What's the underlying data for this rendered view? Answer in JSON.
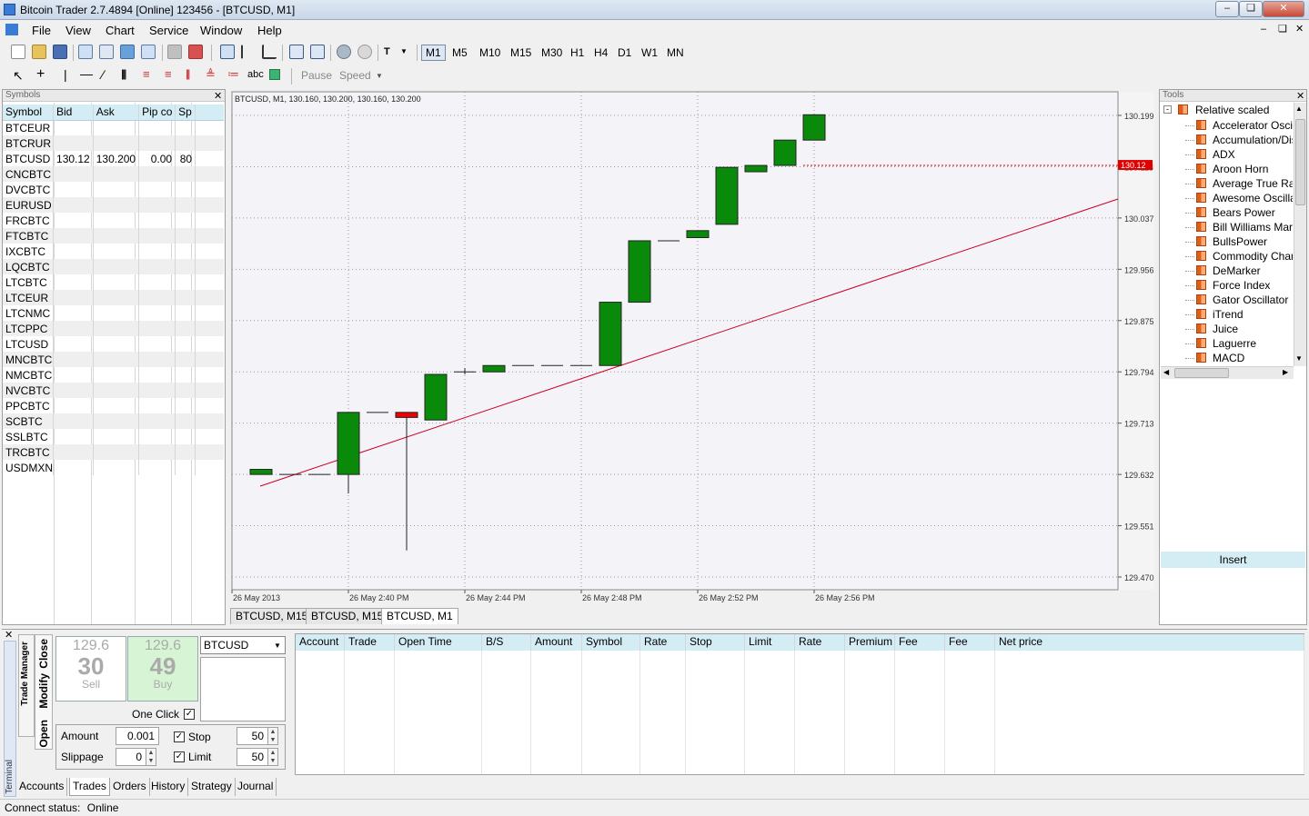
{
  "window": {
    "title": "Bitcoin Trader 2.7.4894 [Online] 123456 - [BTCUSD, M1]"
  },
  "menu": [
    "File",
    "View",
    "Chart",
    "Service",
    "Window",
    "Help"
  ],
  "timeframes": [
    "M1",
    "M5",
    "M10",
    "M15",
    "M30",
    "H1",
    "H4",
    "D1",
    "W1",
    "MN"
  ],
  "selected_timeframe": "M1",
  "toolbar2": {
    "abc": "abc",
    "pause": "Pause",
    "speed": "Speed"
  },
  "symbols_panel": {
    "title": "Symbols",
    "columns": [
      "Symbol",
      "Bid",
      "Ask",
      "Pip co",
      "Sp"
    ],
    "rows": [
      [
        "BTCEUR",
        "",
        "",
        "",
        ""
      ],
      [
        "BTCRUR",
        "",
        "",
        "",
        ""
      ],
      [
        "BTCUSD",
        "130.12",
        "130.200",
        "0.00",
        "80"
      ],
      [
        "CNCBTC",
        "",
        "",
        "",
        ""
      ],
      [
        "DVCBTC",
        "",
        "",
        "",
        ""
      ],
      [
        "EURUSD",
        "",
        "",
        "",
        ""
      ],
      [
        "FRCBTC",
        "",
        "",
        "",
        ""
      ],
      [
        "FTCBTC",
        "",
        "",
        "",
        ""
      ],
      [
        "IXCBTC",
        "",
        "",
        "",
        ""
      ],
      [
        "LQCBTC",
        "",
        "",
        "",
        ""
      ],
      [
        "LTCBTC",
        "",
        "",
        "",
        ""
      ],
      [
        "LTCEUR",
        "",
        "",
        "",
        ""
      ],
      [
        "LTCNMC",
        "",
        "",
        "",
        ""
      ],
      [
        "LTCPPC",
        "",
        "",
        "",
        ""
      ],
      [
        "LTCUSD",
        "",
        "",
        "",
        ""
      ],
      [
        "MNCBTC",
        "",
        "",
        "",
        ""
      ],
      [
        "NMCBTC",
        "",
        "",
        "",
        ""
      ],
      [
        "NVCBTC",
        "",
        "",
        "",
        ""
      ],
      [
        "PPCBTC",
        "",
        "",
        "",
        ""
      ],
      [
        "SCBTC",
        "",
        "",
        "",
        ""
      ],
      [
        "SSLBTC",
        "",
        "",
        "",
        ""
      ],
      [
        "TRCBTC",
        "",
        "",
        "",
        ""
      ],
      [
        "USDMXN",
        "",
        "",
        "",
        ""
      ]
    ]
  },
  "chart": {
    "header": "BTCUSD, M1, 130.160, 130.200, 130.160, 130.200",
    "y_ticks": [
      "130.199",
      "130.118",
      "130.037",
      "129.956",
      "129.875",
      "129.794",
      "129.713",
      "129.632",
      "129.551",
      "129.470"
    ],
    "x_ticks": [
      "26 May 2013",
      "26 May 2:40 PM",
      "26 May 2:44 PM",
      "26 May 2:48 PM",
      "26 May 2:52 PM",
      "26 May 2:56 PM"
    ],
    "current_price_label": "130.12",
    "tabs": [
      "BTCUSD, M15",
      "BTCUSD, M15",
      "BTCUSD, M1"
    ],
    "active_tab": 2
  },
  "chart_data": {
    "type": "candlestick",
    "title": "BTCUSD, M1, 130.160, 130.200, 130.160, 130.200",
    "ylim": [
      129.47,
      130.199
    ],
    "current_price": 130.12,
    "candles": [
      {
        "o": 129.632,
        "h": 129.64,
        "l": 129.632,
        "c": 129.64
      },
      {
        "o": 129.632,
        "h": 129.632,
        "l": 129.632,
        "c": 129.632
      },
      {
        "o": 129.632,
        "h": 129.632,
        "l": 129.632,
        "c": 129.632
      },
      {
        "o": 129.632,
        "h": 129.73,
        "l": 129.602,
        "c": 129.73
      },
      {
        "o": 129.73,
        "h": 129.73,
        "l": 129.73,
        "c": 129.73
      },
      {
        "o": 129.73,
        "h": 129.73,
        "l": 129.512,
        "c": 129.722
      },
      {
        "o": 129.718,
        "h": 129.79,
        "l": 129.718,
        "c": 129.79
      },
      {
        "o": 129.794,
        "h": 129.8,
        "l": 129.79,
        "c": 129.794
      },
      {
        "o": 129.794,
        "h": 129.804,
        "l": 129.794,
        "c": 129.804
      },
      {
        "o": 129.804,
        "h": 129.804,
        "l": 129.804,
        "c": 129.804
      },
      {
        "o": 129.804,
        "h": 129.804,
        "l": 129.804,
        "c": 129.804
      },
      {
        "o": 129.804,
        "h": 129.804,
        "l": 129.804,
        "c": 129.804
      },
      {
        "o": 129.804,
        "h": 129.904,
        "l": 129.804,
        "c": 129.904
      },
      {
        "o": 129.904,
        "h": 130.001,
        "l": 129.904,
        "c": 130.001
      },
      {
        "o": 130.001,
        "h": 130.001,
        "l": 130.001,
        "c": 130.001
      },
      {
        "o": 130.006,
        "h": 130.017,
        "l": 130.006,
        "c": 130.017
      },
      {
        "o": 130.027,
        "h": 130.117,
        "l": 130.027,
        "c": 130.117
      },
      {
        "o": 130.11,
        "h": 130.12,
        "l": 130.11,
        "c": 130.12
      },
      {
        "o": 130.12,
        "h": 130.16,
        "l": 130.12,
        "c": 130.16
      },
      {
        "o": 130.16,
        "h": 130.2,
        "l": 130.16,
        "c": 130.2
      }
    ]
  },
  "tools_panel": {
    "title": "Tools",
    "root": "Relative scaled",
    "items": [
      "Accelerator Oscillator",
      "Accumulation/Distribution",
      "ADX",
      "Aroon Horn",
      "Average True Range",
      "Awesome Oscillator",
      "Bears Power",
      "Bill Williams Market",
      "BullsPower",
      "Commodity Channel",
      "DeMarker",
      "Force Index",
      "Gator Oscillator",
      "iTrend",
      "Juice",
      "Laguerre",
      "MACD"
    ],
    "insert": "Insert"
  },
  "trade_manager": {
    "side_tabs": [
      "Close",
      "Modify",
      "Open"
    ],
    "side_label": "Trade Manager",
    "sell": {
      "top": "129.6",
      "big": "30",
      "label": "Sell"
    },
    "buy": {
      "top": "129.6",
      "big": "49",
      "label": "Buy"
    },
    "symbol": "BTCUSD",
    "one_click": "One Click",
    "amount_label": "Amount",
    "amount": "0.001",
    "slippage_label": "Slippage",
    "slippage": "0",
    "stop_label": "Stop",
    "stop": "50",
    "limit_label": "Limit",
    "limit": "50"
  },
  "trades_table": {
    "columns": [
      "Account",
      "Trade",
      "Open Time",
      "B/S",
      "Amount",
      "Symbol",
      "Rate",
      "Stop",
      "Limit",
      "Rate",
      "Premium",
      "Fee",
      "Fee",
      "Net price"
    ]
  },
  "terminal_label": "Terminal",
  "bottom_tabs": [
    "Accounts",
    "Trades",
    "Orders",
    "History",
    "Strategy",
    "Journal"
  ],
  "active_bottom_tab": "Trades",
  "status": {
    "label": "Connect status:",
    "value": "Online"
  }
}
